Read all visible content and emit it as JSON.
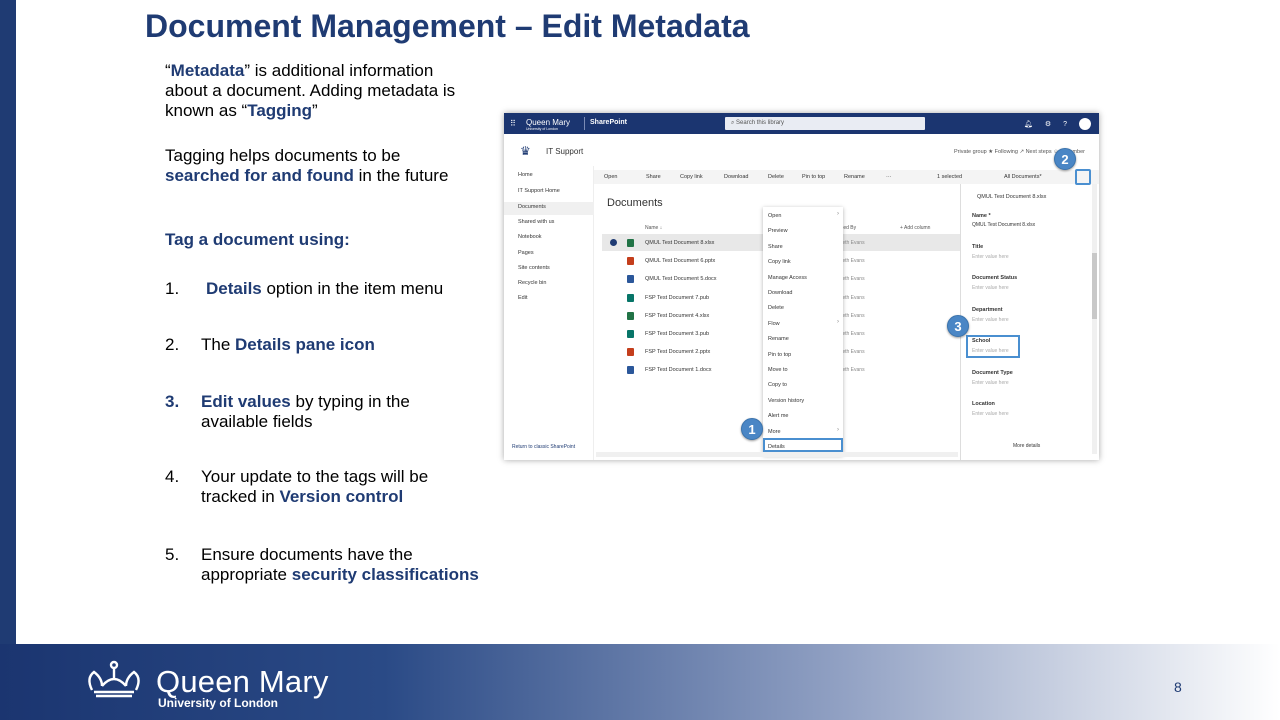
{
  "slide": {
    "title": "Document Management – Edit Metadata",
    "page_number": "8"
  },
  "intro": {
    "q_open": "“",
    "metadata_word": "Metadata",
    "line1_rest": "” is additional information about a document.  Adding metadata is known as “",
    "tagging_word": "Tagging",
    "q_close": "”"
  },
  "tagging_para": {
    "part1": "Tagging helps documents to be ",
    "bold": "searched for and found",
    "part2": " in the future"
  },
  "tag_heading": "Tag a document using:",
  "steps": [
    {
      "num": "1.",
      "bold": "Details",
      "rest": " option in the item menu"
    },
    {
      "num": "2.",
      "pre": "The ",
      "bold": "Details pane icon"
    },
    {
      "num": "3.",
      "bold": "Edit values",
      "rest": " by typing in the available fields"
    },
    {
      "num": "4.",
      "pre": "Your update to the tags will be tracked in ",
      "bold": "Version control"
    },
    {
      "num": "5.",
      "pre": "Ensure documents have the appropriate ",
      "bold": "security classifications"
    }
  ],
  "footer": {
    "brand_main": "Queen Mary",
    "brand_sub": "University of London"
  },
  "screenshot": {
    "suite_brand": "Queen Mary",
    "suite_brand_sub": "University of London",
    "app_name": "SharePoint",
    "search_placeholder": "Search this library",
    "site_name": "IT Support",
    "site_right": "Private group  ★ Following   ↗ Next steps   ☺ 1 member",
    "nav": [
      "Home",
      "IT Support Home",
      "Documents",
      "Shared with us",
      "Notebook",
      "Pages",
      "Site contents",
      "Recycle bin",
      "Edit"
    ],
    "nav_bottom": "Return to classic SharePoint",
    "commands": [
      "Open",
      "Share",
      "Copy link",
      "Download",
      "Delete",
      "Pin to top",
      "Rename",
      "···"
    ],
    "selected_count": "1 selected",
    "view_name": "All Documents*",
    "library_title": "Documents",
    "col_name": "Name ↓",
    "col_modified_by": "Modified By",
    "add_column": "+ Add column",
    "files": [
      {
        "name": "QMUL Test Document 8.xlsx",
        "color": "#217346",
        "by": "Gareth Evans"
      },
      {
        "name": "QMUL Test Document 6.pptx",
        "color": "#c43e1c",
        "by": "Gareth Evans"
      },
      {
        "name": "QMUL Test Document 5.docx",
        "color": "#2b579a",
        "by": "Gareth Evans"
      },
      {
        "name": "FSP Test Document 7.pub",
        "color": "#077568",
        "by": "Gareth Evans"
      },
      {
        "name": "FSP Test Document 4.xlsx",
        "color": "#217346",
        "by": "Gareth Evans"
      },
      {
        "name": "FSP Test Document 3.pub",
        "color": "#077568",
        "by": "Gareth Evans"
      },
      {
        "name": "FSP Test Document 2.pptx",
        "color": "#c43e1c",
        "by": "Gareth Evans"
      },
      {
        "name": "FSP Test Document 1.docx",
        "color": "#2b579a",
        "by": "Gareth Evans"
      }
    ],
    "context_menu": [
      "Open",
      "Preview",
      "Share",
      "Copy link",
      "Manage Access",
      "Download",
      "Delete",
      "Flow",
      "Rename",
      "Pin to top",
      "Move to",
      "Copy to",
      "Version history",
      "Alert me",
      "More",
      "Details"
    ],
    "pane": {
      "doc_title": "QMUL Test Document 8.xlsx",
      "name_label": "Name *",
      "name_value": "QMUL Test Document 8.xlsx",
      "placeholder": "Enter value here",
      "fields": [
        "Title",
        "Document Status",
        "Department",
        "School",
        "Document Type",
        "Location"
      ],
      "more_details": "More details"
    },
    "badges": [
      "1",
      "2",
      "3"
    ]
  }
}
